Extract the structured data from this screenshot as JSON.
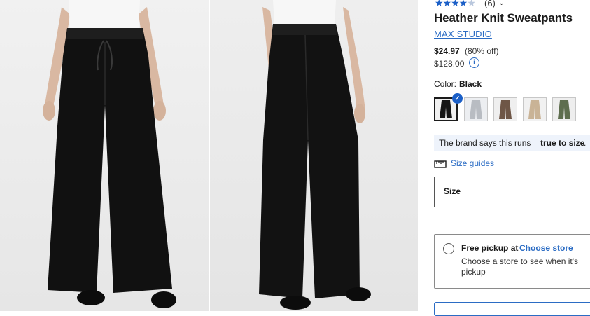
{
  "gallery": {
    "images": [
      {
        "name": "front-view",
        "alt": "Front view of black wide-leg sweatpants"
      },
      {
        "name": "back-view",
        "alt": "Back view of black wide-leg sweatpants"
      }
    ]
  },
  "product": {
    "rating": {
      "value": 4.5,
      "max": 5,
      "count_label": "(6)"
    },
    "title": "Heather Knit Sweatpants",
    "brand": "MAX STUDIO",
    "price": {
      "current": "$24.97",
      "discount": "(80% off)",
      "original": "$128.00",
      "info_icon": "info-icon"
    },
    "color": {
      "label": "Color:",
      "selected": "Black"
    },
    "swatches": [
      {
        "name": "Black",
        "color": "#151515",
        "selected": true
      },
      {
        "name": "Heather Grey",
        "color": "#b8bcc2",
        "selected": false
      },
      {
        "name": "Brown",
        "color": "#6e5646",
        "selected": false
      },
      {
        "name": "Beige",
        "color": "#c9b396",
        "selected": false
      },
      {
        "name": "Olive",
        "color": "#5e6e4e",
        "selected": false
      }
    ],
    "fit": {
      "prefix": "The brand says this runs",
      "emphasis": "true to size",
      "suffix": "."
    },
    "size_guides": {
      "label": "Size guides",
      "icon": "ruler-icon"
    },
    "size": {
      "label": "Size"
    },
    "pickup": {
      "title": "Free pickup at",
      "link": "Choose store",
      "description_line1": "Choose a store to see when it's",
      "description_line2": "pickup"
    }
  },
  "colors": {
    "accent": "#2b6cc4",
    "check": "#1b5fc7",
    "fit_bg": "#eef3fb"
  }
}
